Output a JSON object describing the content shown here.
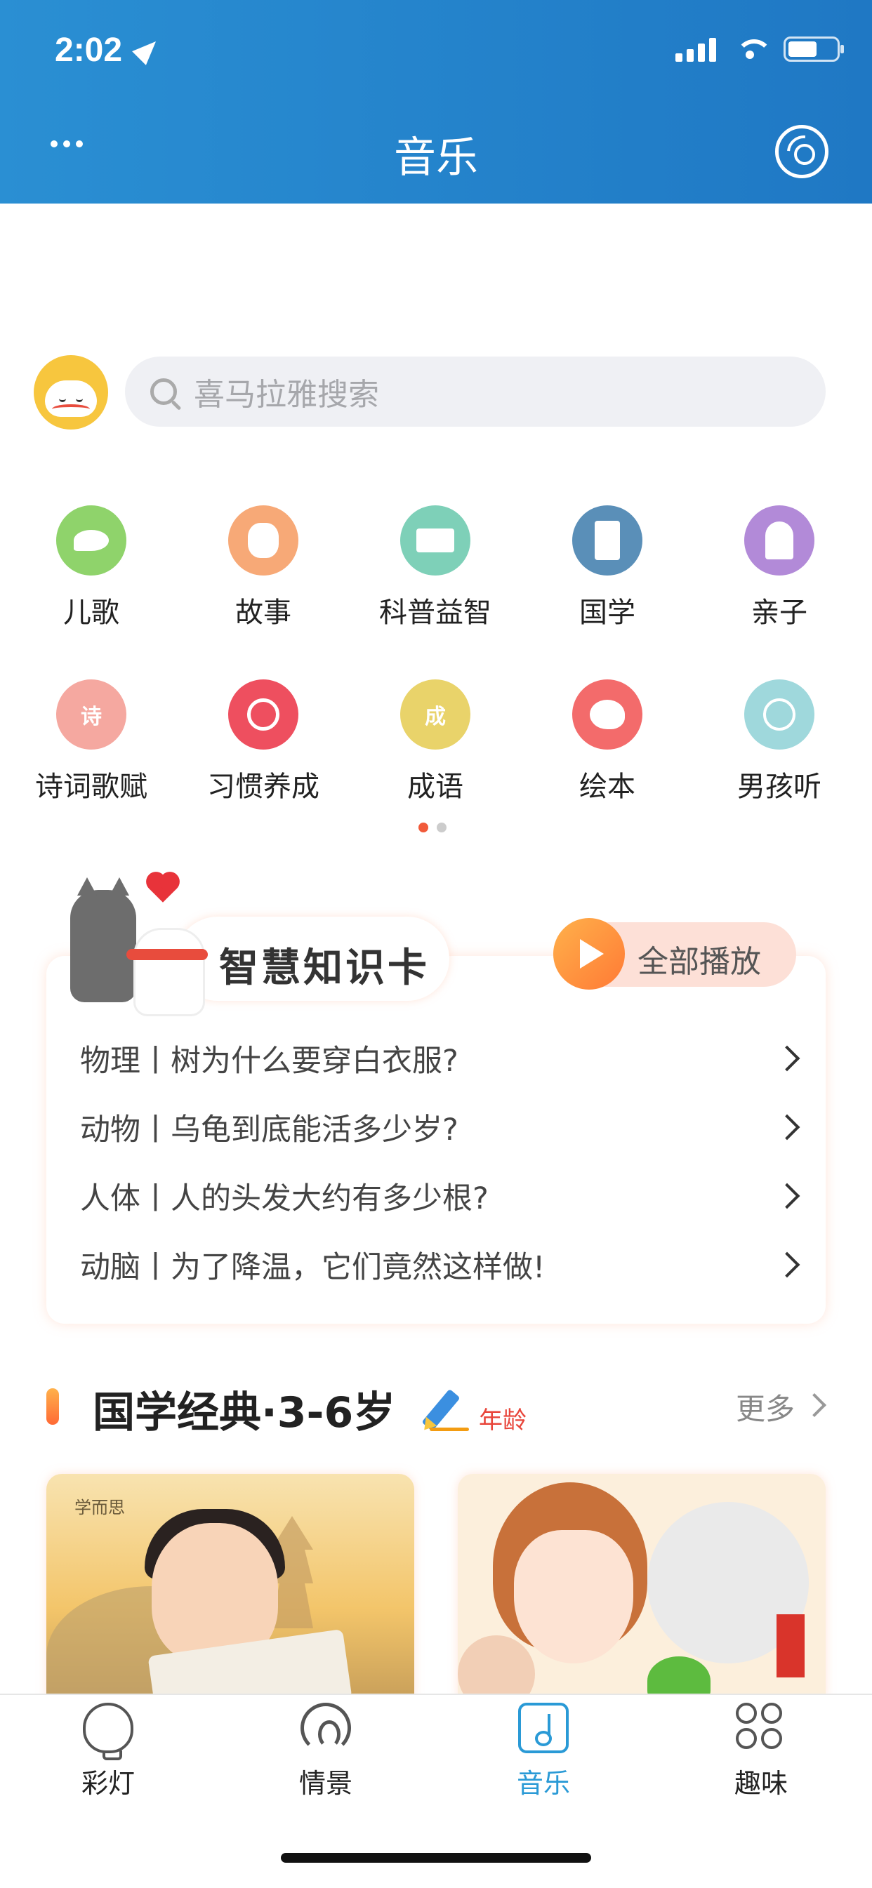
{
  "status_bar": {
    "time": "2:02"
  },
  "nav": {
    "title": "音乐"
  },
  "search": {
    "placeholder": "喜马拉雅搜索"
  },
  "categories": [
    {
      "label": "儿歌",
      "icon": "bird-icon",
      "color": "#8fd36b"
    },
    {
      "label": "故事",
      "icon": "bear-icon",
      "color": "#f7a977"
    },
    {
      "label": "科普益智",
      "icon": "book-icon",
      "color": "#7ed0b8"
    },
    {
      "label": "国学",
      "icon": "scroll-icon",
      "color": "#5a8fb8"
    },
    {
      "label": "亲子",
      "icon": "family-icon",
      "color": "#b28ad8"
    },
    {
      "label": "诗词歌赋",
      "icon": "poem-icon",
      "color": "#f5a8a0",
      "icon_text": "诗"
    },
    {
      "label": "习惯养成",
      "icon": "alarm-clock-icon",
      "color": "#ee4f5f"
    },
    {
      "label": "成语",
      "icon": "idiom-icon",
      "color": "#e9d36a",
      "icon_text": "成"
    },
    {
      "label": "绘本",
      "icon": "palette-icon",
      "color": "#f36b6b"
    },
    {
      "label": "男孩听",
      "icon": "boy-icon",
      "color": "#9fd8dc"
    }
  ],
  "pager": {
    "dots": 2,
    "active": 0,
    "active_color": "#f15a3a",
    "inactive_color": "#cccccc"
  },
  "knowledge_card": {
    "title": "智慧知识卡",
    "play_all": "全部播放",
    "items": [
      "物理丨树为什么要穿白衣服?",
      "动物丨乌龟到底能活多少岁?",
      "人体丨人的头发大约有多少根?",
      "动脑丨为了降温，它们竟然这样做!"
    ]
  },
  "section": {
    "title": "国学经典·3-6岁",
    "age_label": "年龄",
    "more": "更多",
    "thumb_logo": "学而思"
  },
  "tabs": [
    {
      "label": "彩灯",
      "icon": "bulb-icon",
      "active": false
    },
    {
      "label": "情景",
      "icon": "ear-icon",
      "active": false
    },
    {
      "label": "音乐",
      "icon": "music-note-icon",
      "active": true
    },
    {
      "label": "趣味",
      "icon": "grid-icon",
      "active": false
    }
  ],
  "colors": {
    "header_blue": "#2386cc",
    "accent_blue": "#2a9ad6",
    "accent_orange": "#ff7a35"
  }
}
